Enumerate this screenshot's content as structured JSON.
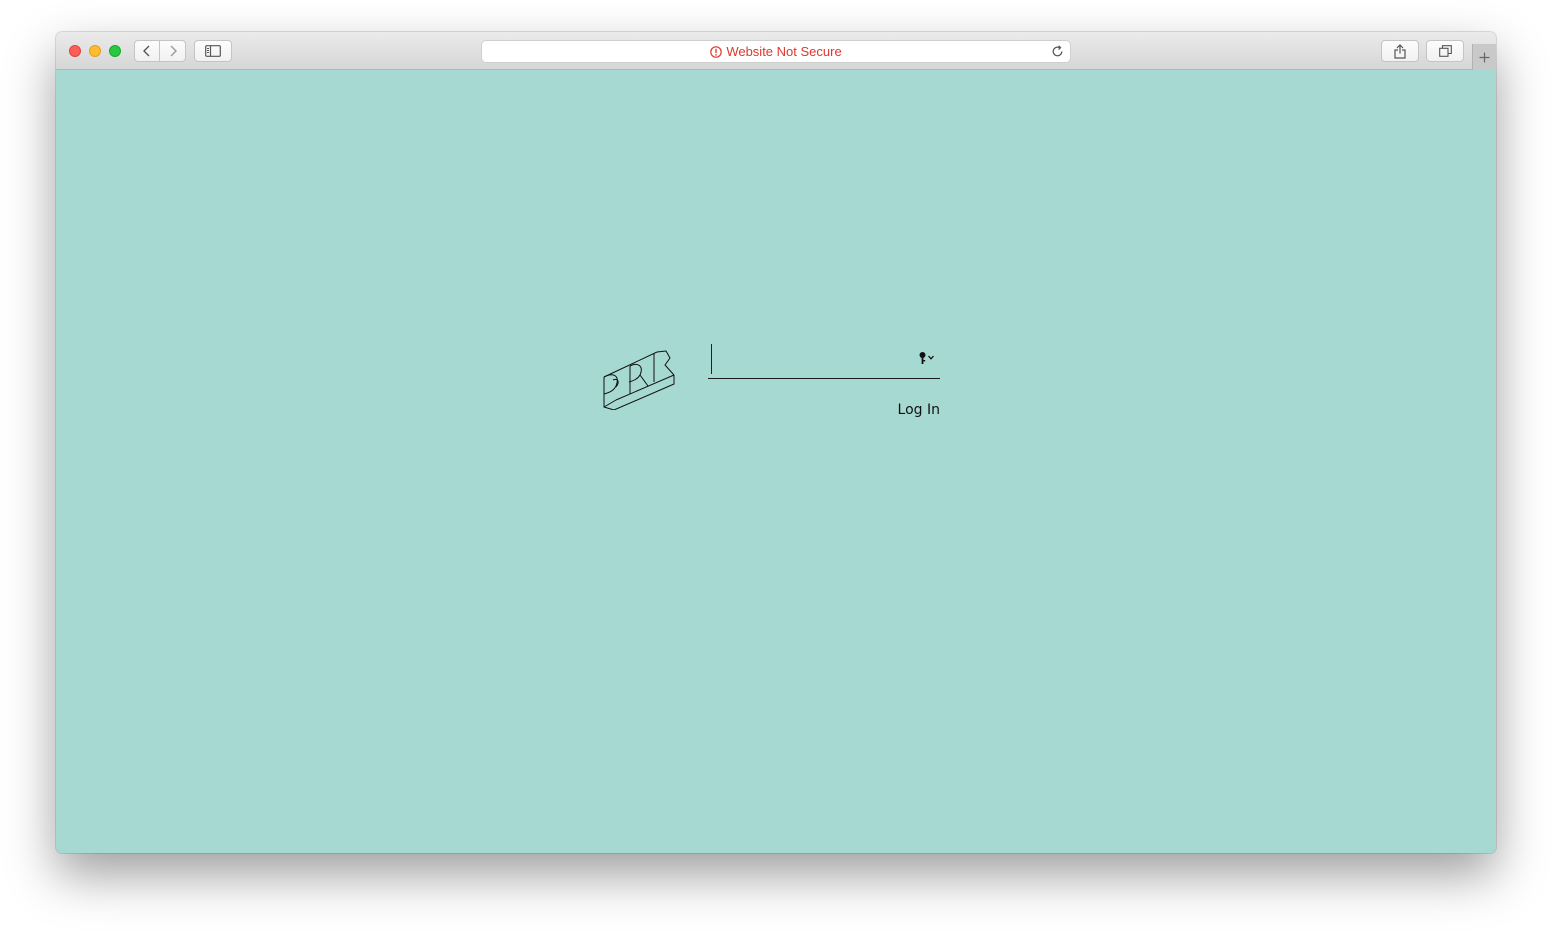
{
  "browser": {
    "address_bar": {
      "security_text": "Website Not Secure",
      "warning_color": "#e0362c"
    },
    "icons": {
      "back": "chevron-left-icon",
      "forward": "chevron-right-icon",
      "sidebar": "sidebar-icon",
      "reload": "reload-icon",
      "share": "share-icon",
      "tabs": "tabs-overview-icon",
      "new_tab": "plus-icon"
    }
  },
  "page": {
    "background_color": "#a7d9d3",
    "login": {
      "password_value": "",
      "submit_label": "Log In"
    },
    "icons": {
      "logo": "logo-icon",
      "password_autofill": "key-icon"
    }
  }
}
